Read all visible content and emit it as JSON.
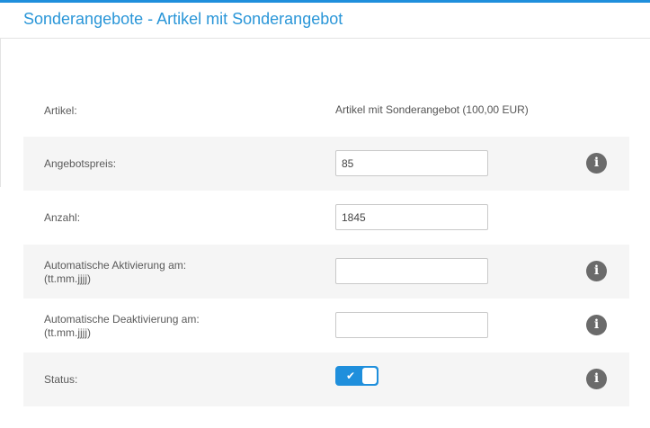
{
  "header": {
    "title": "Sonderangebote - Artikel mit Sonderangebot"
  },
  "form": {
    "artikel": {
      "label": "Artikel:",
      "value": "Artikel mit Sonderangebot (100,00 EUR)"
    },
    "angebotspreis": {
      "label": "Angebotspreis:",
      "value": "85"
    },
    "anzahl": {
      "label": "Anzahl:",
      "value": "1845"
    },
    "aktivierung": {
      "label": "Automatische Aktivierung am:",
      "hint": "(tt.mm.jjjj)",
      "value": ""
    },
    "deaktivierung": {
      "label": "Automatische Deaktivierung am:",
      "hint": "(tt.mm.jjjj)",
      "value": ""
    },
    "status": {
      "label": "Status:",
      "checked": true
    }
  },
  "icons": {
    "info": "i",
    "check": "✔"
  },
  "colors": {
    "accent": "#1f8fdc",
    "title": "#2a96d8",
    "info_icon": "#6b6b6b",
    "row_shade": "#f5f5f5"
  }
}
